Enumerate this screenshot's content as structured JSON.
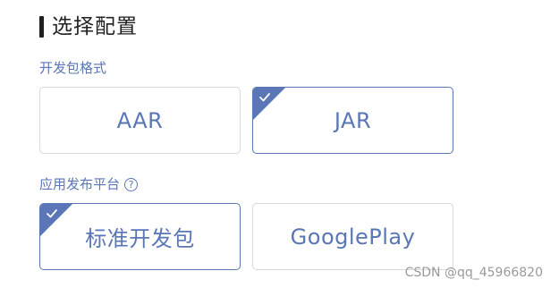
{
  "section": {
    "title": "选择配置"
  },
  "package_format": {
    "label": "开发包格式",
    "options": [
      {
        "label": "AAR",
        "selected": false
      },
      {
        "label": "JAR",
        "selected": true
      }
    ]
  },
  "platform": {
    "label": "应用发布平台",
    "help_icon": "?",
    "options": [
      {
        "label": "标准开发包",
        "selected": true
      },
      {
        "label": "GooglePlay",
        "selected": false
      }
    ]
  },
  "watermark": "CSDN @qq_45966820",
  "colors": {
    "accent": "#5a76b6",
    "border": "#d6d9e0",
    "title_bar": "#1f1f1f"
  }
}
